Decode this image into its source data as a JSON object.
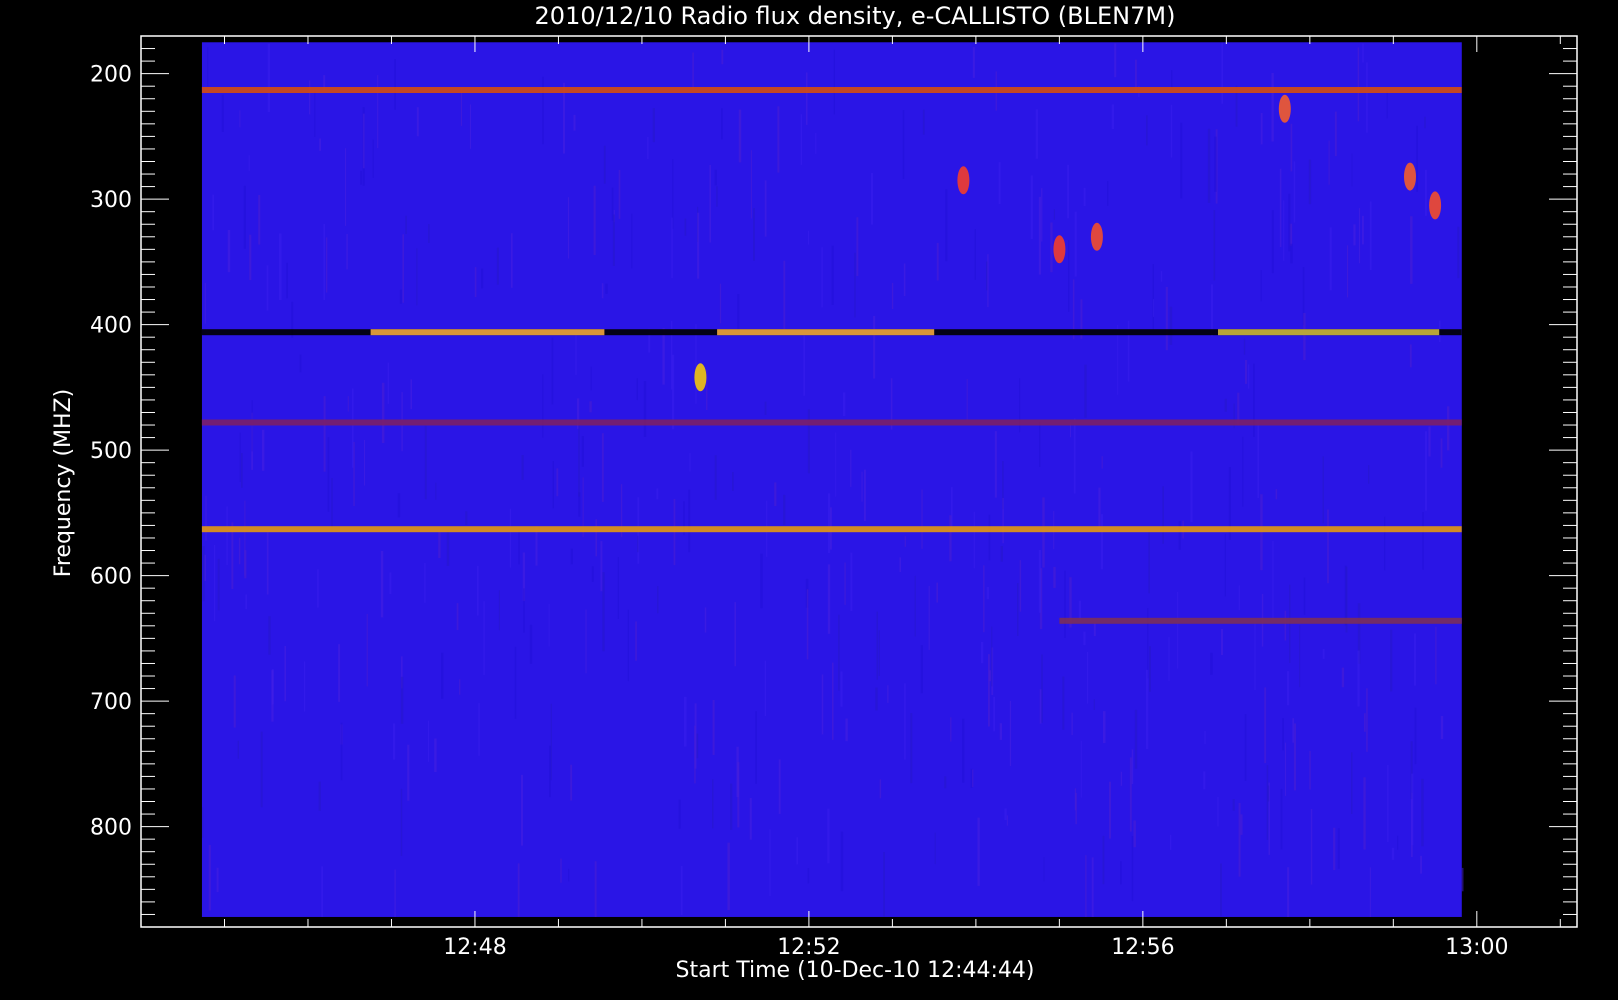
{
  "chart_data": {
    "type": "heatmap",
    "title": "2010/12/10  Radio flux density, e-CALLISTO (BLEN7M)",
    "xlabel": "Start Time (10-Dec-10 12:44:44)",
    "ylabel": "Frequency (MHZ)",
    "x_ticks": [
      {
        "label": "12:48",
        "minute": 48
      },
      {
        "label": "12:52",
        "minute": 52
      },
      {
        "label": "12:56",
        "minute": 56
      },
      {
        "label": "13:00",
        "minute": 60
      }
    ],
    "y_ticks": [
      200,
      300,
      400,
      500,
      600,
      700,
      800
    ],
    "xlim_minutes": [
      44.0,
      61.2
    ],
    "data_time_range_minutes": [
      44.73,
      59.82
    ],
    "ylim": [
      170,
      880
    ],
    "y_inverted": true,
    "data_freq_range": [
      175,
      872
    ],
    "colormap": "blue-red-yellow-white",
    "features": [
      {
        "kind": "band",
        "freq": 406,
        "t_start": 44.73,
        "t_end": 59.82,
        "color": "#000000"
      },
      {
        "kind": "band",
        "freq": 406,
        "t_start": 46.75,
        "t_end": 49.55,
        "color": "#ffb040"
      },
      {
        "kind": "band",
        "freq": 406,
        "t_start": 50.9,
        "t_end": 53.5,
        "color": "#ffb040"
      },
      {
        "kind": "band",
        "freq": 406,
        "t_start": 56.9,
        "t_end": 59.55,
        "color": "#d8c040"
      },
      {
        "kind": "band",
        "freq": 563,
        "t_start": 44.73,
        "t_end": 59.82,
        "color": "#f0a000"
      },
      {
        "kind": "band",
        "freq": 213,
        "t_start": 44.73,
        "t_end": 59.82,
        "color": "#e05000"
      },
      {
        "kind": "band",
        "freq": 478,
        "t_start": 44.73,
        "t_end": 59.82,
        "color": "#802060"
      },
      {
        "kind": "band",
        "freq": 636,
        "t_start": 55.0,
        "t_end": 59.82,
        "color": "#803050"
      },
      {
        "kind": "burst",
        "time": 55.0,
        "freq": 340,
        "color": "#ff4020"
      },
      {
        "kind": "burst",
        "time": 55.45,
        "freq": 330,
        "color": "#ff5020"
      },
      {
        "kind": "burst",
        "time": 57.7,
        "freq": 228,
        "color": "#ff6020"
      },
      {
        "kind": "burst",
        "time": 59.2,
        "freq": 282,
        "color": "#ff6020"
      },
      {
        "kind": "burst",
        "time": 59.5,
        "freq": 305,
        "color": "#ff5020"
      },
      {
        "kind": "burst",
        "time": 53.85,
        "freq": 285,
        "color": "#ff4020"
      },
      {
        "kind": "burst",
        "time": 50.7,
        "freq": 442,
        "color": "#ffd000"
      }
    ]
  }
}
